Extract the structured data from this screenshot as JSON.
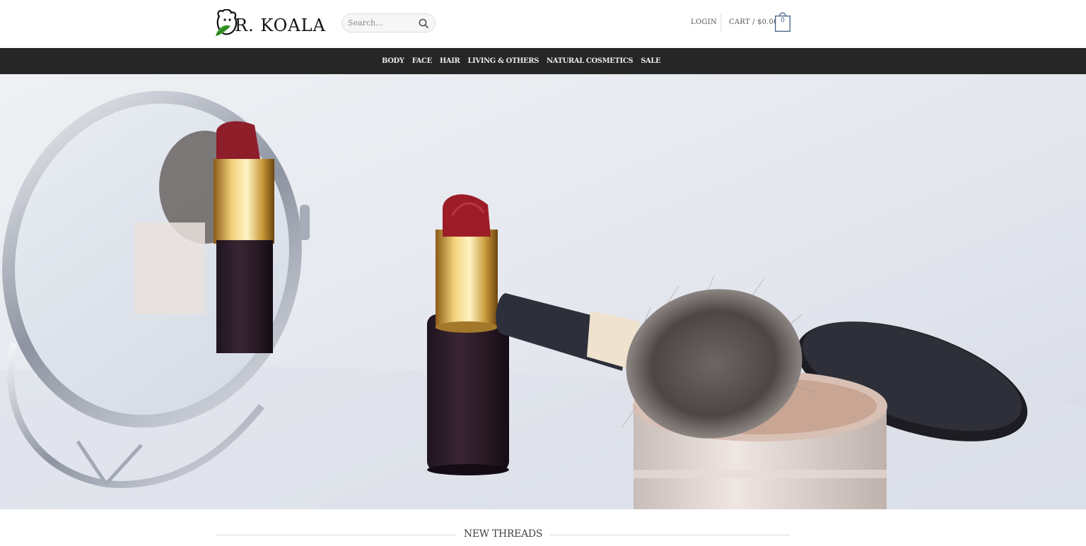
{
  "header": {
    "logo_text": "R. KOALA",
    "search_placeholder": "Search...",
    "login_label": "LOGIN",
    "cart_label": "CART / $0.00",
    "cart_count": "0"
  },
  "nav": {
    "items": [
      {
        "label": "BODY"
      },
      {
        "label": "FACE"
      },
      {
        "label": "HAIR"
      },
      {
        "label": "LIVING & OTHERS"
      },
      {
        "label": "NATURAL COSMETICS"
      },
      {
        "label": "SALE"
      }
    ]
  },
  "hero": {
    "image_subject": "cosmetics-banner"
  },
  "section": {
    "title": "NEW THREADS"
  },
  "colors": {
    "nav_background": "#262626",
    "accent": "#446084",
    "logo_green": "#3a9a2a"
  }
}
